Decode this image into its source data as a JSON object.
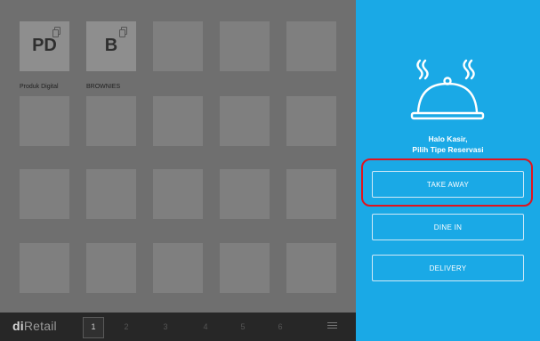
{
  "products": [
    {
      "initial": "PD",
      "name": "Produk Digital"
    },
    {
      "initial": "B",
      "name": "BROWNIES"
    }
  ],
  "footer": {
    "logo_prefix": "di",
    "logo_suffix": "Retail",
    "pages": [
      "1",
      "2",
      "3",
      "4",
      "5",
      "6"
    ],
    "active_page": "1"
  },
  "reservation_panel": {
    "greeting_line1": "Halo Kasir,",
    "greeting_line2": "Pilih Tipe Reservasi",
    "options": [
      "TAKE AWAY",
      "DINE IN",
      "DELIVERY"
    ],
    "highlighted_option": "TAKE AWAY"
  },
  "colors": {
    "panel_background": "#1aa9e6",
    "highlight": "#e0141e",
    "overlay": "#6f6f6f"
  }
}
